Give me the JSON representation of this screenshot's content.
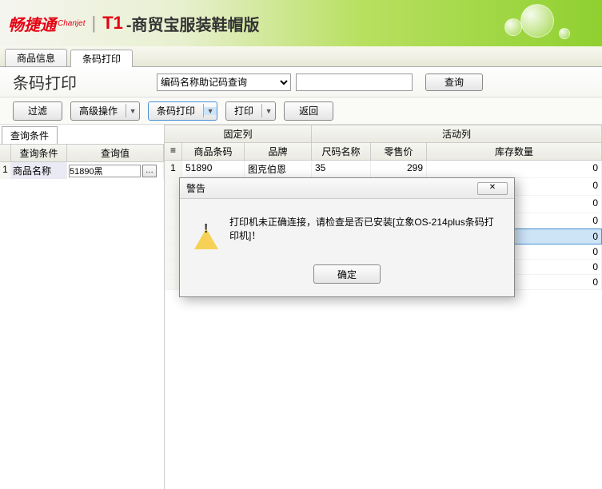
{
  "header": {
    "logo": "畅捷通",
    "logo_sub": "Chanjet",
    "product_code": "T1",
    "product_name": "-商贸宝服装鞋帽版"
  },
  "tabs": {
    "tab1": "商品信息",
    "tab2": "条码打印"
  },
  "page": {
    "title": "条码打印",
    "select_value": "编码名称助记码查询",
    "search_value": "",
    "query_btn": "查询"
  },
  "toolbar": {
    "filter": "过滤",
    "advanced": "高级操作",
    "barcode_print": "条码打印",
    "print": "打印",
    "back": "返回"
  },
  "sidebar": {
    "tab": "查询条件",
    "col_cond": "查询条件",
    "col_val": "查询值",
    "row1": {
      "idx": "1",
      "cond": "商品名称",
      "val": "51890黑"
    }
  },
  "grid": {
    "group_fixed": "固定列",
    "group_active": "活动列",
    "cols": {
      "c1": "商品条码",
      "c2": "品牌",
      "c3": "尺码名称",
      "c4": "零售价",
      "c5": "库存数量"
    },
    "rows": [
      {
        "idx": "1",
        "c1": "51890",
        "c2": "图克伯恩",
        "c3": "35",
        "c4": "299",
        "c5": "0"
      },
      {
        "idx": "",
        "c1": "",
        "c2": "",
        "c3": "",
        "c4": "",
        "c5": "0"
      },
      {
        "idx": "",
        "c1": "",
        "c2": "",
        "c3": "",
        "c4": "",
        "c5": "0"
      },
      {
        "idx": "",
        "c1": "",
        "c2": "",
        "c3": "",
        "c4": "",
        "c5": "0"
      },
      {
        "idx": "",
        "c1": "",
        "c2": "",
        "c3": "",
        "c4": "",
        "c5": "0"
      },
      {
        "idx": "",
        "c1": "",
        "c2": "",
        "c3": "",
        "c4": "",
        "c5": "0"
      },
      {
        "idx": "",
        "c1": "",
        "c2": "",
        "c3": "",
        "c4": "",
        "c5": "0"
      },
      {
        "idx": "",
        "c1": "",
        "c2": "",
        "c3": "",
        "c4": "",
        "c5": "0"
      }
    ]
  },
  "dialog": {
    "title": "警告",
    "close": "✕",
    "message": "打印机未正确连接，请检查是否已安装[立象OS-214plus条码打印机]！",
    "ok": "确定"
  }
}
